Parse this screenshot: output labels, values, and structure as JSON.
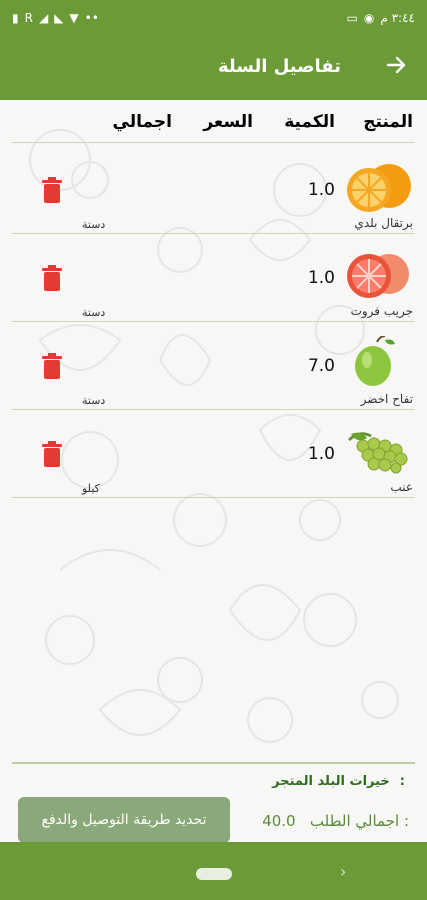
{
  "status_bar": {
    "time": "٣:٤٤ م",
    "right_icons": [
      "whatsapp-icon",
      "sim-icon"
    ],
    "left_icons": [
      "battery-icon",
      "signal-icon",
      "wifi-icon"
    ],
    "dots": "••"
  },
  "app_bar": {
    "title": "تفاصيل السلة"
  },
  "table": {
    "headers": {
      "product": "المنتج",
      "quantity": "الكمية",
      "price": "السعر",
      "total": "اجمالي"
    },
    "rows": [
      {
        "name": "برتقال بلدي",
        "quantity": "1.0",
        "unit": "دستة",
        "image": "orange"
      },
      {
        "name": "جريب فروت",
        "quantity": "1.0",
        "unit": "دستة",
        "image": "grapefruit"
      },
      {
        "name": "تفاح اخضر",
        "quantity": "7.0",
        "unit": "دستة",
        "image": "green-apple"
      },
      {
        "name": "عنب",
        "quantity": "1.0",
        "unit": "كيلو",
        "image": "grapes"
      }
    ]
  },
  "footer": {
    "store_label": "المتجر:",
    "store_name": "خيرات البلد",
    "order_total_label": "اجمالي الطلب :",
    "order_total_value": "40.0",
    "pay_button": "تحديد طريقة التوصيل والدفع"
  },
  "colors": {
    "primary": "#6b9a36",
    "trash": "#e53935",
    "button": "#8ba87a"
  }
}
